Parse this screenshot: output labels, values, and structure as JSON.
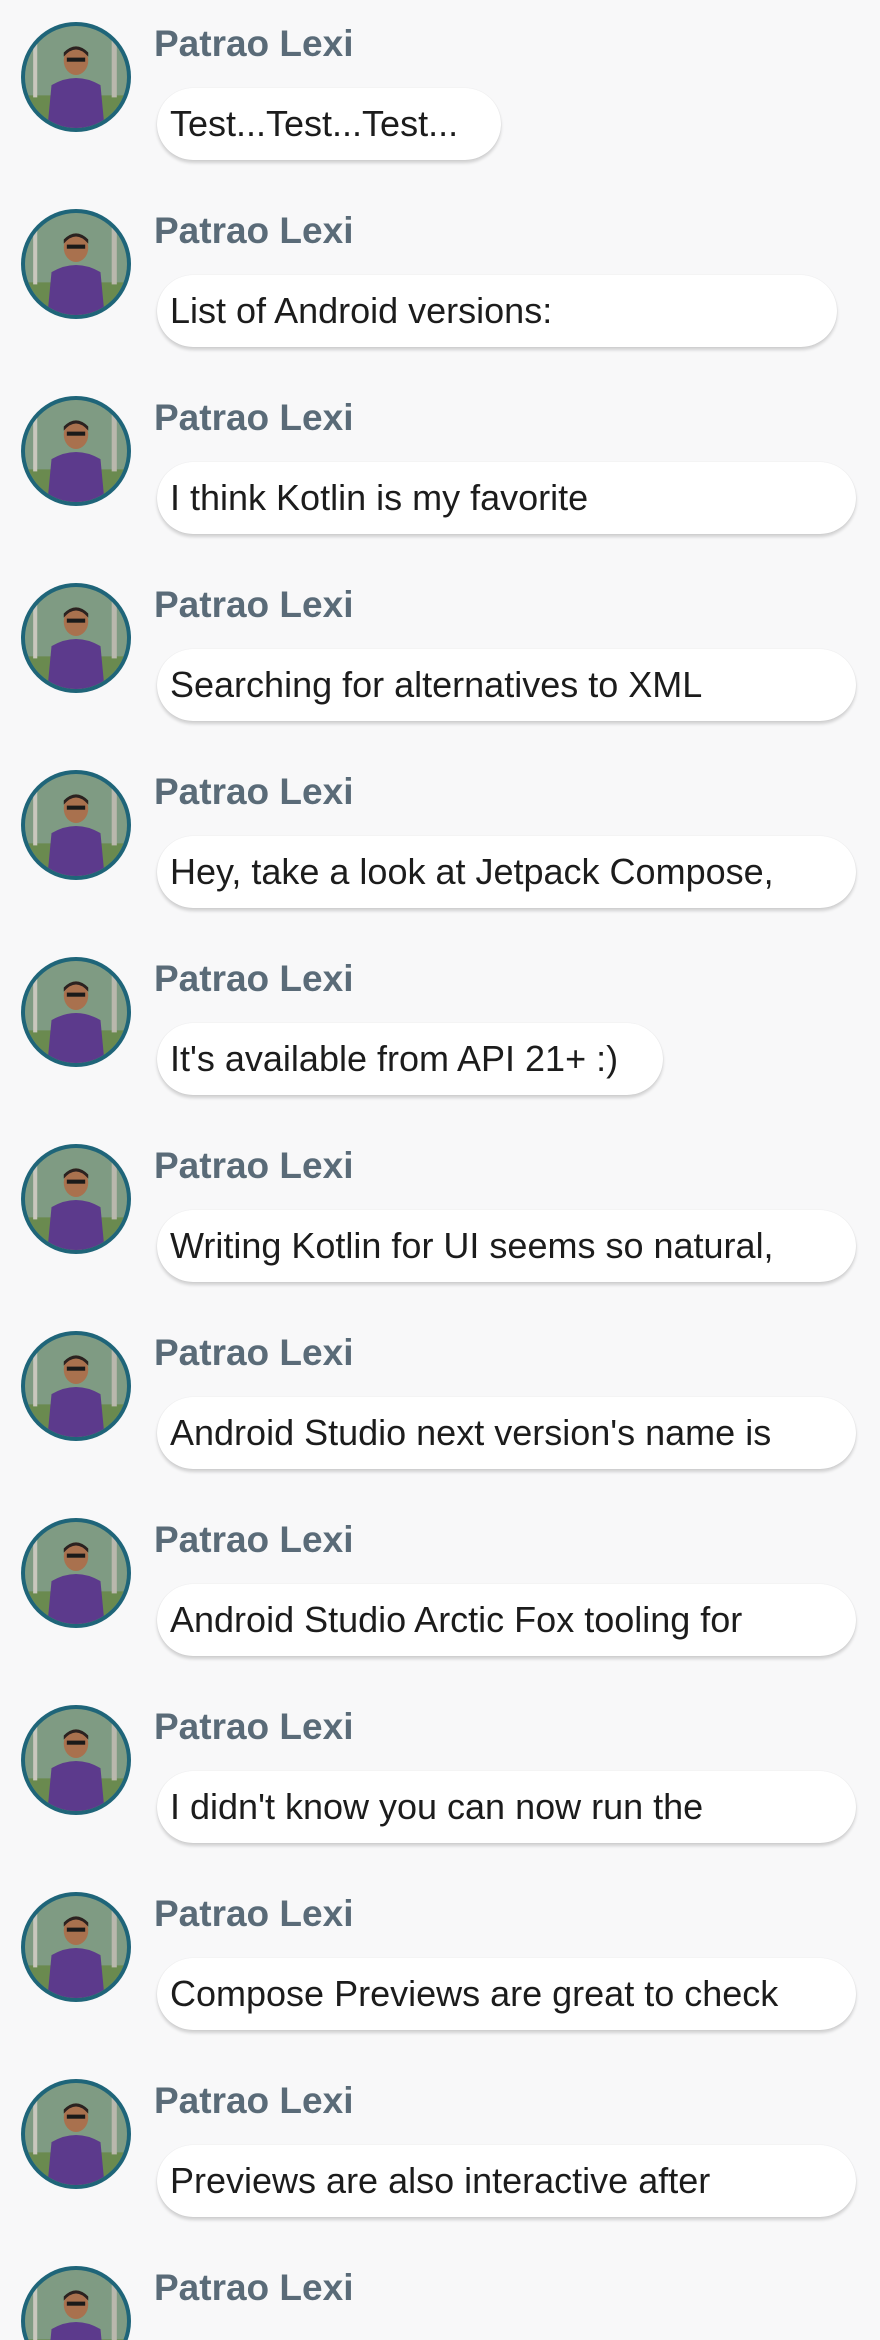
{
  "messages": [
    {
      "author": "Patrao Lexi",
      "text": "Test...Test...Test..."
    },
    {
      "author": "Patrao Lexi",
      "text": "List of Android versions:"
    },
    {
      "author": "Patrao Lexi",
      "text": "I think Kotlin is my favorite"
    },
    {
      "author": "Patrao Lexi",
      "text": "Searching for alternatives to XML"
    },
    {
      "author": "Patrao Lexi",
      "text": "Hey, take a look at Jetpack Compose,"
    },
    {
      "author": "Patrao Lexi",
      "text": "It's available from API 21+ :)"
    },
    {
      "author": "Patrao Lexi",
      "text": "Writing Kotlin for UI seems so natural,"
    },
    {
      "author": "Patrao Lexi",
      "text": "Android Studio next version's name is"
    },
    {
      "author": "Patrao Lexi",
      "text": "Android Studio Arctic Fox tooling for"
    },
    {
      "author": "Patrao Lexi",
      "text": "I didn't know you can now run the"
    },
    {
      "author": "Patrao Lexi",
      "text": "Compose Previews are great to check"
    },
    {
      "author": "Patrao Lexi",
      "text": "Previews are also interactive after"
    },
    {
      "author": "Patrao Lexi",
      "text": ""
    }
  ]
}
